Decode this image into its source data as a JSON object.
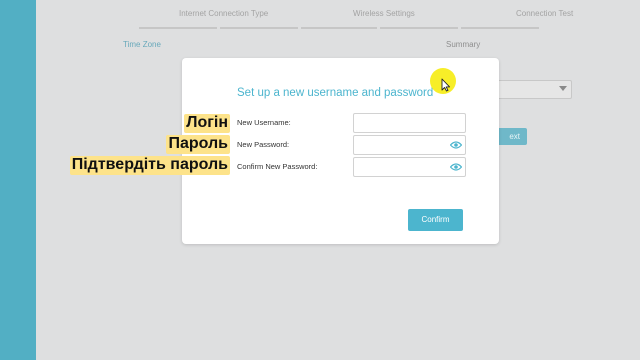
{
  "wizard": {
    "steps_row1": [
      "Internet Connection Type",
      "Wireless Settings",
      "Connection Test"
    ],
    "steps_row2": [
      "Time Zone",
      "Summary"
    ],
    "next_label": "Next",
    "next_label_visible": "ext"
  },
  "modal": {
    "title": "Set up a new username and password",
    "fields": [
      {
        "label": "New Username:",
        "value": "",
        "has_eye": false
      },
      {
        "label": "New Password:",
        "value": "",
        "has_eye": true
      },
      {
        "label": "Confirm New Password:",
        "value": "",
        "has_eye": true
      }
    ],
    "confirm_label": "Confirm"
  },
  "annotations": [
    "Логін",
    "Пароль",
    "Підтвердіть пароль"
  ],
  "icons": {
    "eye": "eye-icon",
    "cursor": "mouse-cursor-icon"
  },
  "colors": {
    "accent": "#4cb5ce",
    "sidebar": "#52afc4",
    "highlight": "#fde38a",
    "cursor_highlight": "#f7ee28"
  }
}
